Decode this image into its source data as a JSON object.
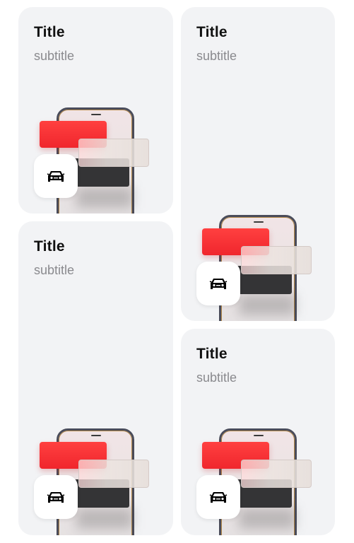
{
  "cards": [
    {
      "title": "Title",
      "subtitle": "subtitle",
      "icon": "car-icon"
    },
    {
      "title": "Title",
      "subtitle": "subtitle",
      "icon": "car-icon"
    },
    {
      "title": "Title",
      "subtitle": "subtitle",
      "icon": "car-icon"
    },
    {
      "title": "Title",
      "subtitle": "subtitle",
      "icon": "car-icon"
    }
  ],
  "colors": {
    "card_background": "#f2f3f5",
    "title": "#111111",
    "subtitle": "#8a8a8e",
    "accent_red": "#f0262d",
    "dark_block": "#343436"
  }
}
